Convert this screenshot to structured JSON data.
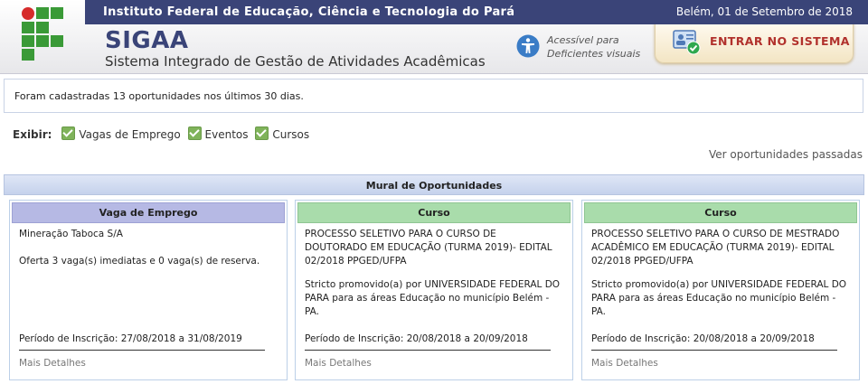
{
  "header": {
    "institution": "Instituto Federal de Educação, Ciência e Tecnologia do Pará",
    "date": "Belém, 01 de Setembro de 2018",
    "app_name": "SIGAA",
    "app_subtitle": "Sistema Integrado de Gestão de Atividades Acadêmicas",
    "accessibility_line1": "Acessível para",
    "accessibility_line2": "Deficientes visuais",
    "login_label": "ENTRAR NO SISTEMA",
    "colors": {
      "topbar": "#3a4478",
      "login_text": "#b1312c",
      "logo_green": "#3a9a37",
      "logo_red": "#d62b2b"
    }
  },
  "info": {
    "message": "Foram cadastradas 13 oportunidades nos últimos 30 dias."
  },
  "filters": {
    "label": "Exibir:",
    "options": [
      {
        "label": "Vagas de Emprego",
        "checked": true
      },
      {
        "label": "Eventos",
        "checked": true
      },
      {
        "label": "Cursos",
        "checked": true
      }
    ]
  },
  "past_link": "Ver oportunidades passadas",
  "mural": {
    "title": "Mural de Oportunidades"
  },
  "cards": [
    {
      "type": "Vaga de Emprego",
      "title": "Mineração Taboca S/A",
      "description": "Oferta 3 vaga(s) imediatas e 0 vaga(s) de reserva.",
      "period": "Período de Inscrição: 27/08/2018 a 31/08/2019",
      "more": "Mais Detalhes"
    },
    {
      "type": "Curso",
      "title": "PROCESSO SELETIVO PARA O CURSO DE DOUTORADO EM EDUCAÇÃO (TURMA 2019)- EDITAL 02/2018 PPGED/UFPA",
      "description": "Stricto promovido(a) por UNIVERSIDADE FEDERAL DO PARA para as áreas Educação no município Belém - PA.",
      "period": "Período de Inscrição: 20/08/2018 a 20/09/2018",
      "more": "Mais Detalhes"
    },
    {
      "type": "Curso",
      "title": "PROCESSO SELETIVO PARA O CURSO DE MESTRADO ACADÊMICO EM EDUCAÇÃO (TURMA 2019)- EDITAL 02/2018 PPGED/UFPA",
      "description": "Stricto promovido(a) por UNIVERSIDADE FEDERAL DO PARA para as áreas Educação no município Belém - PA.",
      "period": "Período de Inscrição: 20/08/2018 a 20/09/2018",
      "more": "Mais Detalhes"
    }
  ]
}
